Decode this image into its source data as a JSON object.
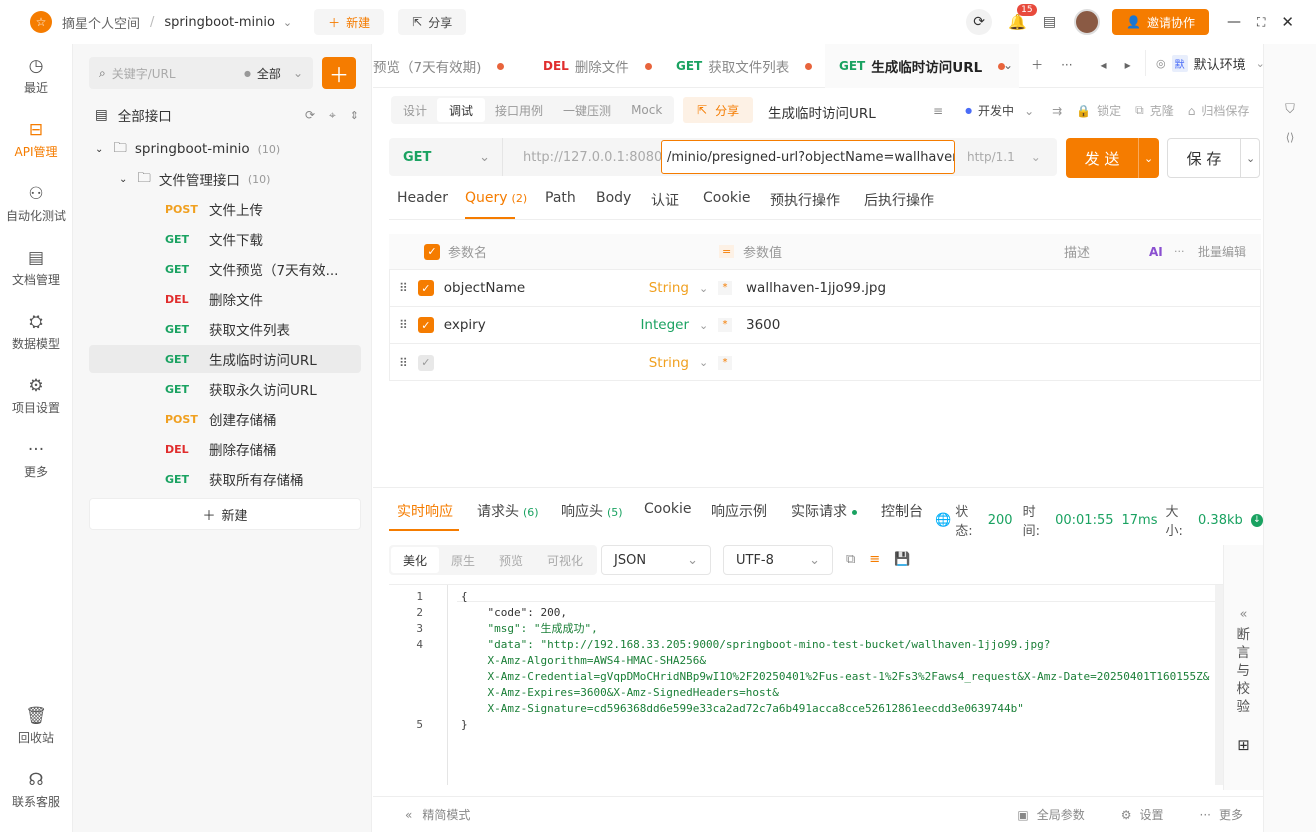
{
  "topbar": {
    "space": "摘星个人空间",
    "separator": "/",
    "project": "springboot-minio",
    "new_label": "新建",
    "share_label": "分享",
    "notif_count": "15",
    "invite_label": "邀请协作"
  },
  "leftnav": [
    {
      "label": "最近",
      "icon": "clock-icon"
    },
    {
      "label": "API管理",
      "icon": "api-icon"
    },
    {
      "label": "自动化测试",
      "icon": "automation-icon"
    },
    {
      "label": "文档管理",
      "icon": "doc-icon"
    },
    {
      "label": "数据模型",
      "icon": "model-icon"
    },
    {
      "label": "项目设置",
      "icon": "settings-icon"
    },
    {
      "label": "更多",
      "icon": "more-icon"
    }
  ],
  "leftnav_bottom": [
    {
      "label": "回收站",
      "icon": "trash-icon"
    },
    {
      "label": "联系客服",
      "icon": "headset-icon"
    }
  ],
  "tree": {
    "search_placeholder": "关键字/URL",
    "filter": "全部",
    "all_label": "全部接口",
    "project": "springboot-minio",
    "project_count": "(10)",
    "folder": "文件管理接口",
    "folder_count": "(10)",
    "new_label": "新建",
    "items": [
      {
        "method": "POST",
        "name": "文件上传"
      },
      {
        "method": "GET",
        "name": "文件下载"
      },
      {
        "method": "GET",
        "name": "文件预览（7天有效..."
      },
      {
        "method": "DEL",
        "name": "删除文件"
      },
      {
        "method": "GET",
        "name": "获取文件列表"
      },
      {
        "method": "GET",
        "name": "生成临时访问URL"
      },
      {
        "method": "GET",
        "name": "获取永久访问URL"
      },
      {
        "method": "POST",
        "name": "创建存储桶"
      },
      {
        "method": "DEL",
        "name": "删除存储桶"
      },
      {
        "method": "GET",
        "name": "获取所有存储桶"
      }
    ]
  },
  "tabs": [
    {
      "method": "",
      "name": "预览（7天有效期)"
    },
    {
      "method": "DEL",
      "name": "删除文件"
    },
    {
      "method": "GET",
      "name": "获取文件列表"
    },
    {
      "method": "GET",
      "name": "生成临时访问URL"
    }
  ],
  "env": "默认环境",
  "subtabs": [
    "设计",
    "调试",
    "接口用例",
    "一键压测",
    "Mock"
  ],
  "share": "分享",
  "api_name": "生成临时访问URL",
  "status_dev": "开发中",
  "actions": [
    "锁定",
    "克隆",
    "归档保存"
  ],
  "request": {
    "method": "GET",
    "base": "http://127.0.0.1:8080",
    "path": "/minio/presigned-url?objectName=wallhaven",
    "protocol": "http/1.1",
    "send": "发 送",
    "save": "保 存"
  },
  "qtabs": [
    {
      "label": "Header"
    },
    {
      "label": "Query",
      "count": "(2)"
    },
    {
      "label": "Path"
    },
    {
      "label": "Body"
    },
    {
      "label": "认证"
    },
    {
      "label": "Cookie"
    },
    {
      "label": "预执行操作"
    },
    {
      "label": "后执行操作"
    }
  ],
  "param_head": {
    "name": "参数名",
    "value": "参数值",
    "desc": "描述",
    "ai": "AI",
    "bulk": "批量编辑"
  },
  "params": [
    {
      "name": "objectName",
      "type": "String",
      "value": "wallhaven-1jjo99.jpg"
    },
    {
      "name": "expiry",
      "type": "Integer",
      "value": "3600"
    },
    {
      "name": "",
      "type": "String",
      "value": ""
    }
  ],
  "resp_tabs": [
    {
      "label": "实时响应"
    },
    {
      "label": "请求头",
      "count": "(6)"
    },
    {
      "label": "响应头",
      "count": "(5)"
    },
    {
      "label": "Cookie"
    },
    {
      "label": "响应示例"
    },
    {
      "label": "实际请求"
    },
    {
      "label": "控制台"
    }
  ],
  "resp_status": {
    "status_label": "状态:",
    "status": "200",
    "time_label": "时间:",
    "time": "00:01:55",
    "ms": "17ms",
    "size_label": "大小:",
    "size": "0.38kb"
  },
  "view_tabs": [
    "美化",
    "原生",
    "预览",
    "可视化"
  ],
  "format": "JSON",
  "encoding": "UTF-8",
  "code_lines": [
    {
      "no": "1",
      "text": "{"
    },
    {
      "no": "2",
      "text": "    \"code\": 200,"
    },
    {
      "no": "3",
      "text": "    \"msg\": \"生成成功\","
    },
    {
      "no": "4",
      "text": "    \"data\": \"http://192.168.33.205:9000/springboot-mino-test-bucket/wallhaven-1jjo99.jpg?"
    },
    {
      "no": "",
      "text": "    X-Amz-Algorithm=AWS4-HMAC-SHA256&"
    },
    {
      "no": "",
      "text": "    X-Amz-Credential=gVqpDMoCHridNBp9wI1O%2F20250401%2Fus-east-1%2Fs3%2Faws4_request&X-Amz-Date=20250401T160155Z&"
    },
    {
      "no": "",
      "text": "    X-Amz-Expires=3600&X-Amz-SignedHeaders=host&"
    },
    {
      "no": "",
      "text": "    X-Amz-Signature=cd596368dd6e599e33ca2ad72c7a6b491acca8cce52612861eecdd3e0639744b\""
    },
    {
      "no": "5",
      "text": "}"
    }
  ],
  "assert_panel": "断言与校验",
  "footer": {
    "simple": "精简模式",
    "global": "全局参数",
    "settings": "设置",
    "more": "更多"
  }
}
